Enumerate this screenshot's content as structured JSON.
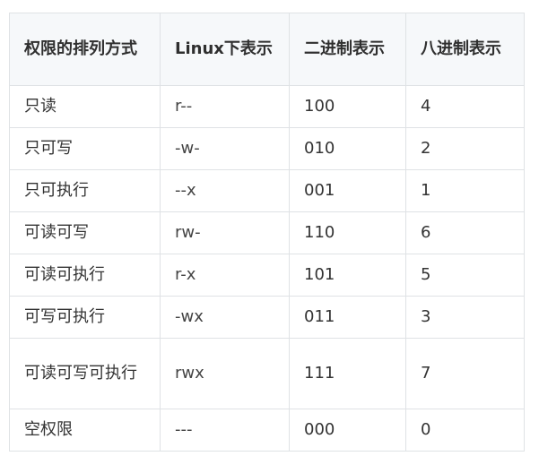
{
  "table": {
    "headers": [
      "权限的排列方式",
      "Linux下表示",
      "二进制表示",
      "八进制表示"
    ],
    "rows": [
      [
        "只读",
        "r--",
        "100",
        "4"
      ],
      [
        "只可写",
        "-w-",
        "010",
        "2"
      ],
      [
        "只可执行",
        "--x",
        "001",
        "1"
      ],
      [
        "可读可写",
        "rw-",
        "110",
        "6"
      ],
      [
        "可读可执行",
        "r-x",
        "101",
        "5"
      ],
      [
        "可写可执行",
        "-wx",
        "011",
        "3"
      ],
      [
        "可读可写可执行",
        "rwx",
        "111",
        "7"
      ],
      [
        "空权限",
        "---",
        "000",
        "0"
      ]
    ]
  }
}
